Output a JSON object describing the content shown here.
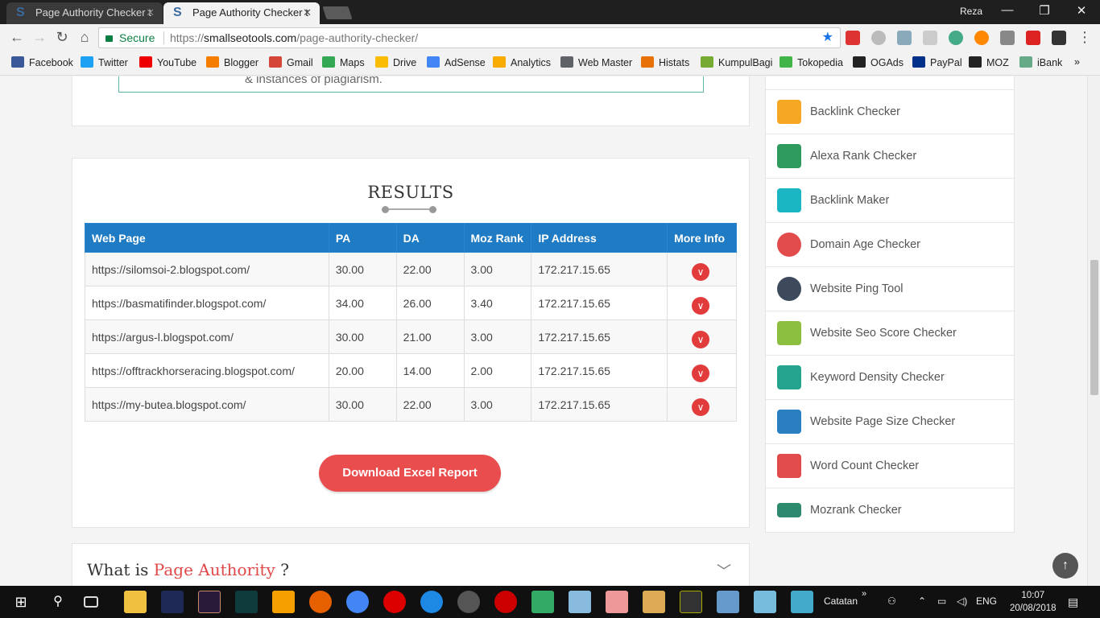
{
  "browser": {
    "tabs": [
      {
        "title": "Page Authority Checker t"
      },
      {
        "title": "Page Authority Checker t"
      }
    ],
    "user": "Reza",
    "secure_label": "Secure",
    "url_proto": "https://",
    "url_host": "smallseotools.com",
    "url_path": "/page-authority-checker/",
    "bookmarks": [
      "Facebook",
      "Twitter",
      "YouTube",
      "Blogger",
      "Gmail",
      "Maps",
      "Drive",
      "AdSense",
      "Analytics",
      "Web Master",
      "Histats",
      "KumpulBagi",
      "Tokopedia",
      "OGAds",
      "PayPal",
      "MOZ",
      "iBank"
    ]
  },
  "prev_section": {
    "text": "& instances of plagiarism."
  },
  "results": {
    "title": "RESULTS",
    "columns": [
      "Web Page",
      "PA",
      "DA",
      "Moz Rank",
      "IP Address",
      "More Info"
    ],
    "rows": [
      {
        "page": "https://silomsoi-2.blogspot.com/",
        "pa": "30.00",
        "da": "22.00",
        "mozrank": "3.00",
        "ip": "172.217.15.65"
      },
      {
        "page": "https://basmatifinder.blogspot.com/",
        "pa": "34.00",
        "da": "26.00",
        "mozrank": "3.40",
        "ip": "172.217.15.65"
      },
      {
        "page": "https://argus-l.blogspot.com/",
        "pa": "30.00",
        "da": "21.00",
        "mozrank": "3.00",
        "ip": "172.217.15.65"
      },
      {
        "page": "https://offtrackhorseracing.blogspot.com/",
        "pa": "20.00",
        "da": "14.00",
        "mozrank": "2.00",
        "ip": "172.217.15.65"
      },
      {
        "page": "https://my-butea.blogspot.com/",
        "pa": "30.00",
        "da": "22.00",
        "mozrank": "3.00",
        "ip": "172.217.15.65"
      }
    ],
    "download_label": "Download Excel Report"
  },
  "faq": {
    "prefix": "What is",
    "highlight": "Page Authority",
    "suffix": "?"
  },
  "sidebar": {
    "items": [
      {
        "label": "Backlink Checker",
        "icon": "link-icon",
        "color": "#f5a623"
      },
      {
        "label": "Alexa Rank Checker",
        "icon": "chart-icon",
        "color": "#2e9b5c"
      },
      {
        "label": "Backlink Maker",
        "icon": "chain-icon",
        "color": "#1bb6c4"
      },
      {
        "label": "Domain Age Checker",
        "icon": "clock-icon",
        "color": "#e24b4b"
      },
      {
        "label": "Website Ping Tool",
        "icon": "ping-icon",
        "color": "#3d4a5c"
      },
      {
        "label": "Website Seo Score Checker",
        "icon": "calculator-icon",
        "color": "#8cbf3f"
      },
      {
        "label": "Keyword Density Checker",
        "icon": "document-icon",
        "color": "#25a58f"
      },
      {
        "label": "Website Page Size Checker",
        "icon": "monitor-icon",
        "color": "#2a7fc1"
      },
      {
        "label": "Word Count Checker",
        "icon": "word-icon",
        "color": "#e24b4b"
      },
      {
        "label": "Mozrank Checker",
        "icon": "moz-icon",
        "color": "#2e8a6e"
      }
    ]
  },
  "taskbar": {
    "tray_label": "Catatan",
    "lang": "ENG",
    "time": "10:07",
    "date": "20/08/2018"
  }
}
